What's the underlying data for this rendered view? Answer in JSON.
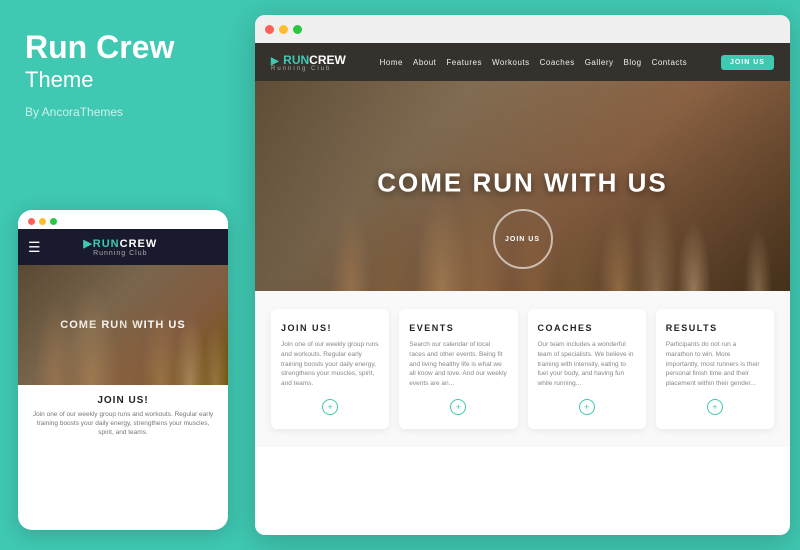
{
  "left": {
    "brand": "Run Crew",
    "subtitle": "Theme",
    "by": "By AncoraThemes"
  },
  "mobile": {
    "logo_run": "RUN",
    "logo_crew": "CREW",
    "tagline": "Running Club",
    "hero_text": "COME RUN WITH US",
    "join_title": "JOIN US!",
    "join_text": "Join one of our weekly group runs and workouts. Regular early training boosts your daily energy, strengthens your muscles, spirit, and teams."
  },
  "desktop": {
    "dots": [
      "red",
      "yellow",
      "green"
    ],
    "nav": {
      "logo_run": "RUN",
      "logo_crew": "CREW",
      "logo_sub": "Running Club",
      "links": [
        "Home",
        "About",
        "Features",
        "Workouts",
        "Coaches",
        "Gallery",
        "Blog",
        "Contacts"
      ],
      "cta": "JOIN US"
    },
    "hero": {
      "title": "COME RUN WITH US",
      "join_label": "JOIN US"
    },
    "cards": [
      {
        "title": "JOIN US!",
        "text": "Join one of our weekly group runs and workouts. Regular early training boosts your daily energy, strengthens your muscles, spirit, and teams."
      },
      {
        "title": "EVENTS",
        "text": "Search our calendar of local races and other events. Being fit and living healthy life is what we all know and love. And our weekly events are an..."
      },
      {
        "title": "COACHES",
        "text": "Our team includes a wonderful team of specialists. We believe in training with intensity, eating to fuel your body, and having fun while running..."
      },
      {
        "title": "RESULTS",
        "text": "Participants do not run a marathon to win. More importantly, most runners is their personal finish time and their placement within their gender..."
      }
    ]
  }
}
